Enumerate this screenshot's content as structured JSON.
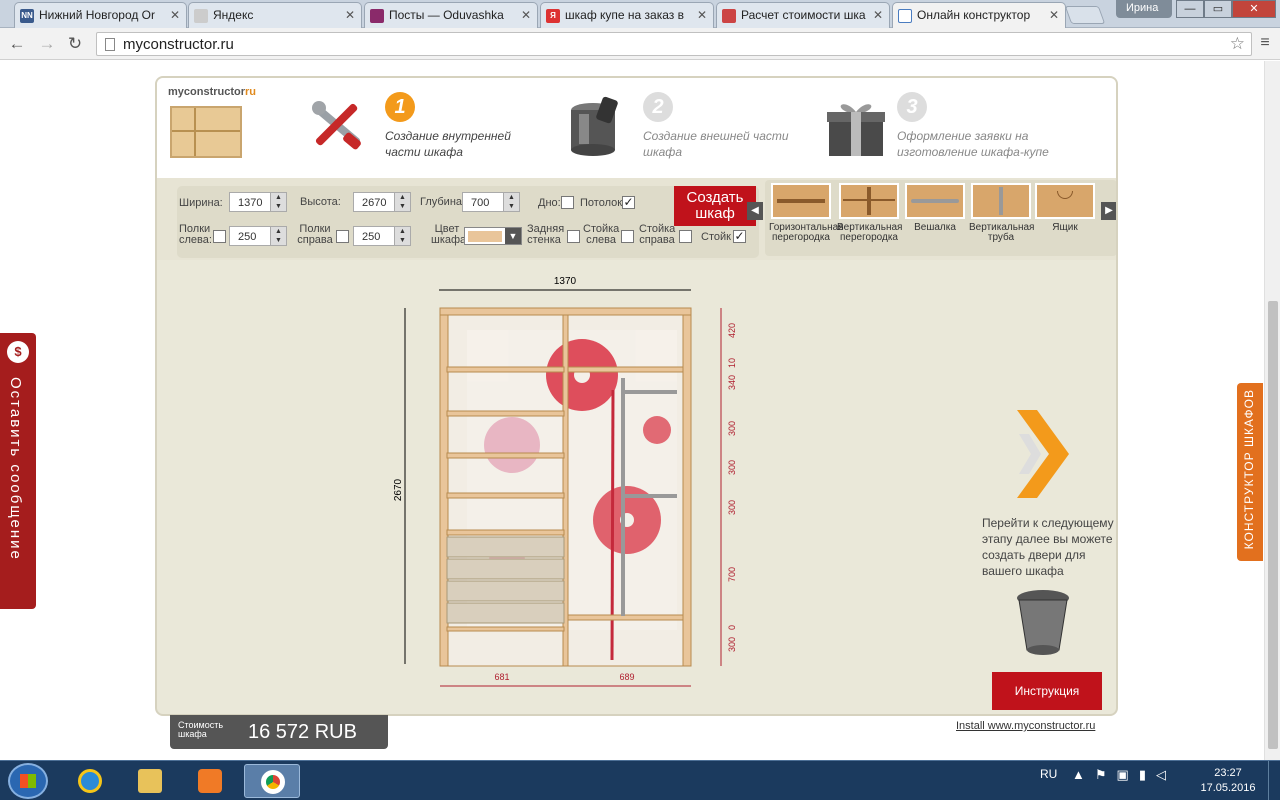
{
  "browser": {
    "tabs": [
      {
        "title": "Нижний Новгород Or",
        "favicon": "NN",
        "color": "#3a5a8c"
      },
      {
        "title": "Яндекс",
        "favicon": "",
        "color": "#cccccc"
      },
      {
        "title": "Посты — Oduvashka",
        "favicon": "",
        "color": "#8a2a6a"
      },
      {
        "title": "шкаф купе на заказ в",
        "favicon": "Я",
        "color": "#d33"
      },
      {
        "title": "Расчет стоимости шка",
        "favicon": "",
        "color": "#c44"
      },
      {
        "title": "Онлайн конструктор",
        "favicon": "",
        "color": "#4a7cc0"
      }
    ],
    "user": "Ирина",
    "url": "myconstructor.ru",
    "window_controls": {
      "minimize": "—",
      "maximize": "▭",
      "close": "✕"
    }
  },
  "header": {
    "logo_brand": "myconstructor",
    "logo_suffix": "ru",
    "steps": [
      {
        "num": "1",
        "text": "Создание внутренней части шкафа",
        "icon": "tools-icon",
        "active": true
      },
      {
        "num": "2",
        "text": "Создание внешней части шкафа",
        "icon": "paint-bucket-icon",
        "active": false
      },
      {
        "num": "3",
        "text": "Оформление заявки на изготовление шкафа-купе",
        "icon": "gift-box-icon",
        "active": false
      }
    ]
  },
  "controls": {
    "width_label": "Ширина:",
    "width": "1370",
    "height_label": "Высота:",
    "height": "2670",
    "depth_label": "Глубина:",
    "depth": "700",
    "bottom_label": "Дно:",
    "bottom_checked": false,
    "ceiling_label": "Потолок:",
    "ceiling_checked": true,
    "shelves_left_label": "Полки слева:",
    "shelves_left_checked": false,
    "shelves_left_value": "250",
    "shelves_right_label": "Полки справа",
    "shelves_right_checked": false,
    "shelves_right_value": "250",
    "color_label": "Цвет шкафа",
    "color": "#e9c59a",
    "back_wall_label": "Задняя стенка",
    "back_wall_checked": false,
    "post_left_label": "Стойка слева",
    "post_left_checked": false,
    "post_right_label": "Стойка справа",
    "post_right_checked": false,
    "post_label": "Стойк",
    "post_checked": true,
    "create_button": "Создать шкаф"
  },
  "elements": [
    {
      "label": "Горизонтальная перегородка",
      "icon": "horizontal-partition-icon"
    },
    {
      "label": "Вертикальная перегородка",
      "icon": "vertical-partition-icon"
    },
    {
      "label": "Вешалка",
      "icon": "hanger-icon"
    },
    {
      "label": "Вертикальная труба",
      "icon": "vertical-pipe-icon"
    },
    {
      "label": "Ящик",
      "icon": "drawer-icon"
    }
  ],
  "drawing": {
    "total_width": "1370",
    "total_height": "2670",
    "left_width": "681",
    "right_width": "689",
    "right_sections": [
      "420",
      "10",
      "340",
      "300",
      "300",
      "300",
      "700",
      "0",
      "300"
    ]
  },
  "hint": "Перейти к следующему этапу далее вы можете создать двери для вашего шкафа",
  "instruction_button": "Инструкция",
  "price": {
    "label": "Стоимость шкафа",
    "value": "16 572  RUB"
  },
  "install_link": "Install www.myconstructor.ru",
  "feedback_tab": "Оставить сообщение",
  "constructor_tab": "КОНСТРУКТОР ШКАФОВ",
  "taskbar": {
    "lang": "RU",
    "time": "23:27",
    "date": "17.05.2016"
  }
}
